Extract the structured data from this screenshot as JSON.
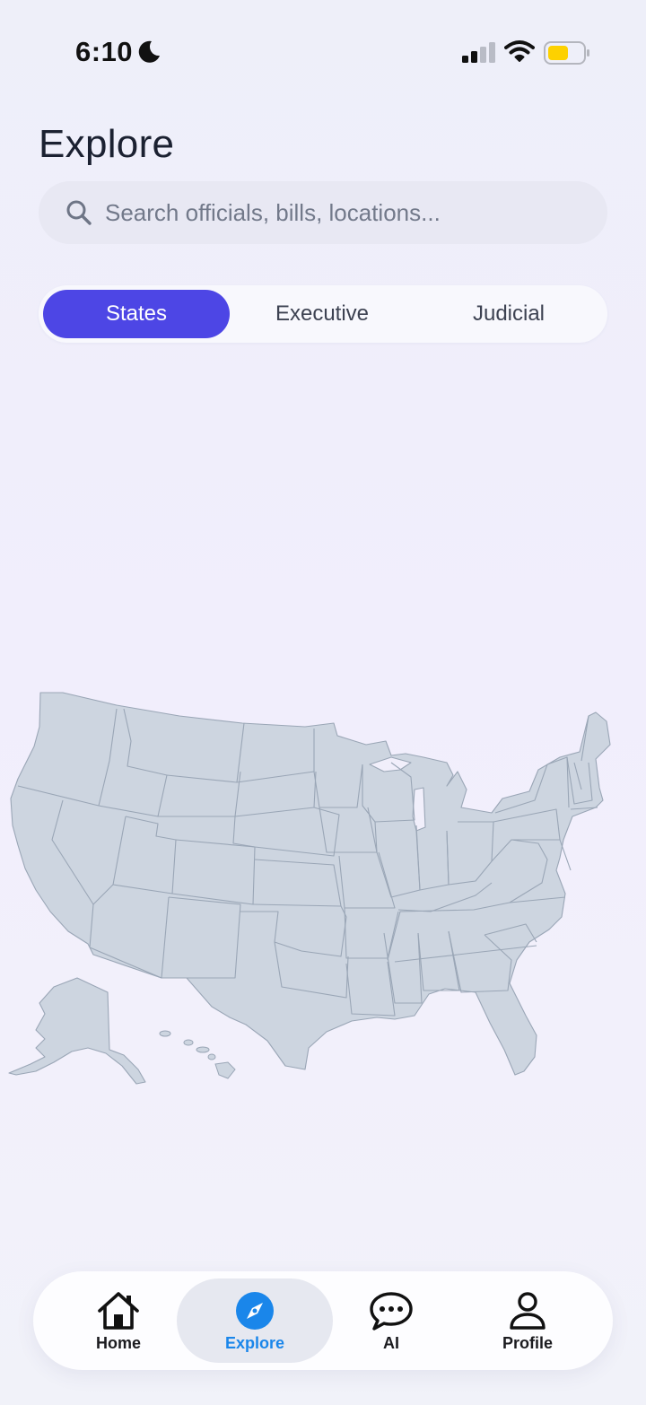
{
  "status_bar": {
    "time": "6:10",
    "icons": [
      "moon-icon",
      "cellular-signal-icon",
      "wifi-icon",
      "battery-icon"
    ],
    "battery_color": "#fdd100"
  },
  "header": {
    "title": "Explore"
  },
  "search": {
    "placeholder": "Search officials, bills, locations...",
    "value": "",
    "icon": "search-icon"
  },
  "segments": {
    "items": [
      {
        "label": "States",
        "active": true
      },
      {
        "label": "Executive",
        "active": false
      },
      {
        "label": "Judicial",
        "active": false
      }
    ],
    "active_color": "#4d46e5"
  },
  "map": {
    "subject": "United States state map",
    "fill_color": "#cdd5e0",
    "stroke_color": "#9aa6b6"
  },
  "tab_bar": {
    "items": [
      {
        "label": "Home",
        "icon": "home-icon",
        "active": false
      },
      {
        "label": "Explore",
        "icon": "compass-icon",
        "active": true
      },
      {
        "label": "AI",
        "icon": "chat-bubble-icon",
        "active": false
      },
      {
        "label": "Profile",
        "icon": "person-icon",
        "active": false
      }
    ],
    "active_color": "#1a86ea"
  }
}
